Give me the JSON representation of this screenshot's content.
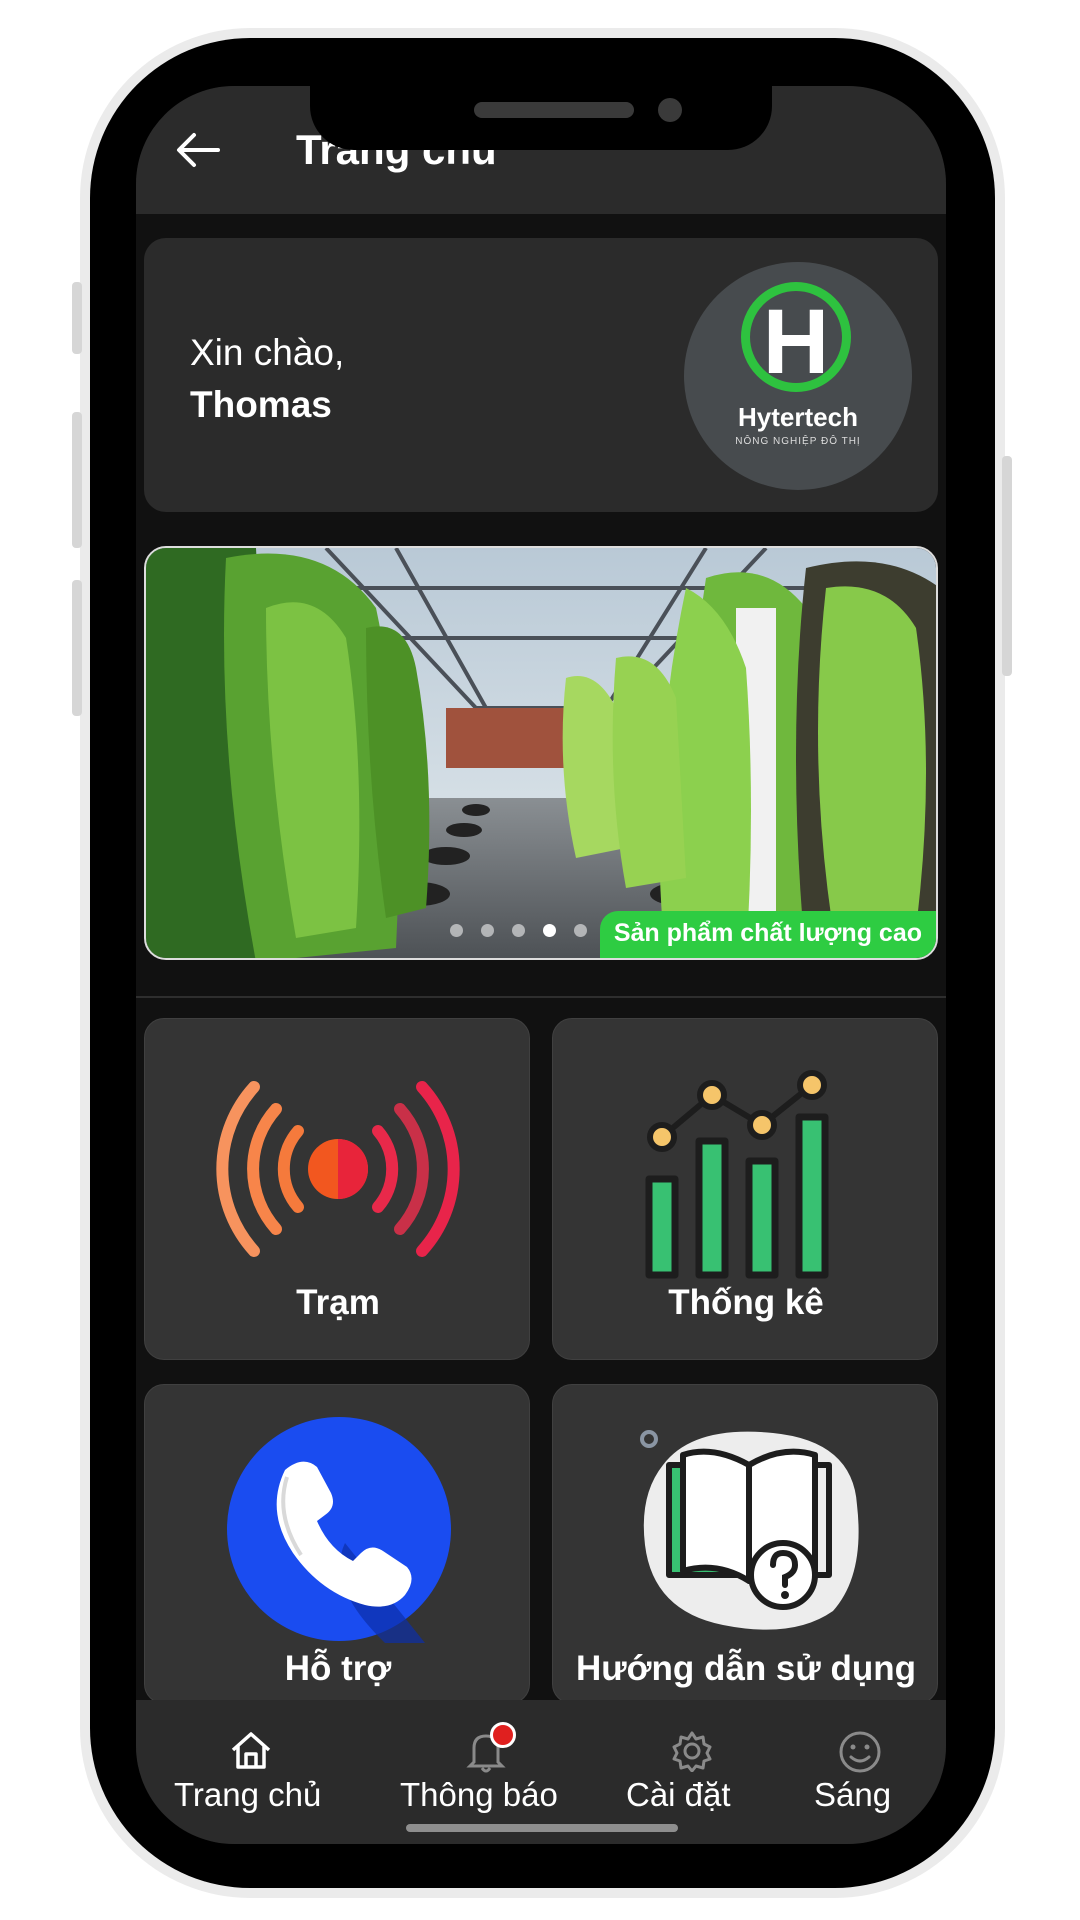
{
  "header": {
    "title": "Trang chủ"
  },
  "greeting": {
    "line": "Xin chào,",
    "name": "Thomas"
  },
  "logo": {
    "letter": "H",
    "name": "Hytertech",
    "tagline": "NÔNG NGHIỆP ĐÔ THỊ"
  },
  "banner": {
    "caption": "Sản phẩm chất lượng cao",
    "slide_count": 5,
    "active_slide": 4
  },
  "tiles": [
    {
      "label": "Trạm",
      "icon": "radar-signal-icon"
    },
    {
      "label": "Thống kê",
      "icon": "bar-chart-icon"
    },
    {
      "label": "Hỗ trợ",
      "icon": "phone-icon"
    },
    {
      "label": "Hướng dẫn sử dụng",
      "icon": "book-question-icon"
    }
  ],
  "nav": [
    {
      "label": "Trang chủ",
      "icon": "home-icon"
    },
    {
      "label": "Thông báo",
      "icon": "bell-icon"
    },
    {
      "label": "Cài đặt",
      "icon": "gear-icon"
    },
    {
      "label": "Sáng",
      "icon": "smile-icon"
    }
  ],
  "colors": {
    "accent_green": "#2ecc42",
    "badge_red": "#e0201f",
    "phone_blue": "#1a4cf0",
    "chart_green": "#38c172",
    "dot_yellow": "#f5c56a"
  }
}
